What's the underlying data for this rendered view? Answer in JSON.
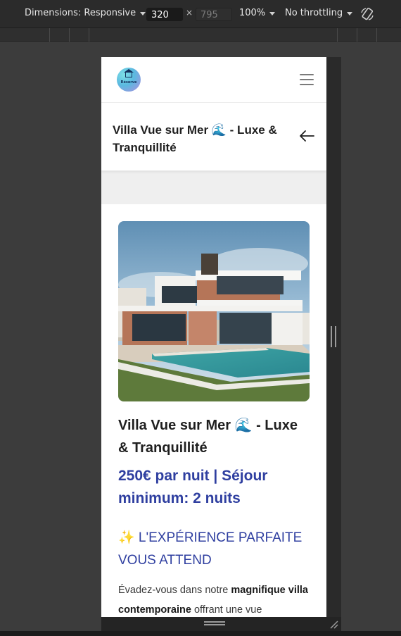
{
  "devtools": {
    "dimensions_label": "Dimensions: Responsive",
    "width": "320",
    "times": "×",
    "height_placeholder": "795",
    "zoom": "100%",
    "throttling": "No throttling"
  },
  "site": {
    "logo_text": "Réserve",
    "title": "Villa Vue sur Mer 🌊 - Luxe & Tranquillité"
  },
  "listing": {
    "title": "Villa Vue sur Mer 🌊 - Luxe & Tranquillité",
    "price": "250€ par nuit | Séjour minimum: 2 nuits",
    "section_heading": "✨ L'EXPÉRIENCE PARFAITE VOUS ATTEND",
    "desc_part1": "Évadez-vous dans notre ",
    "desc_bold1": "magnifique villa contemporaine",
    "desc_part2": " offrant une vue"
  }
}
